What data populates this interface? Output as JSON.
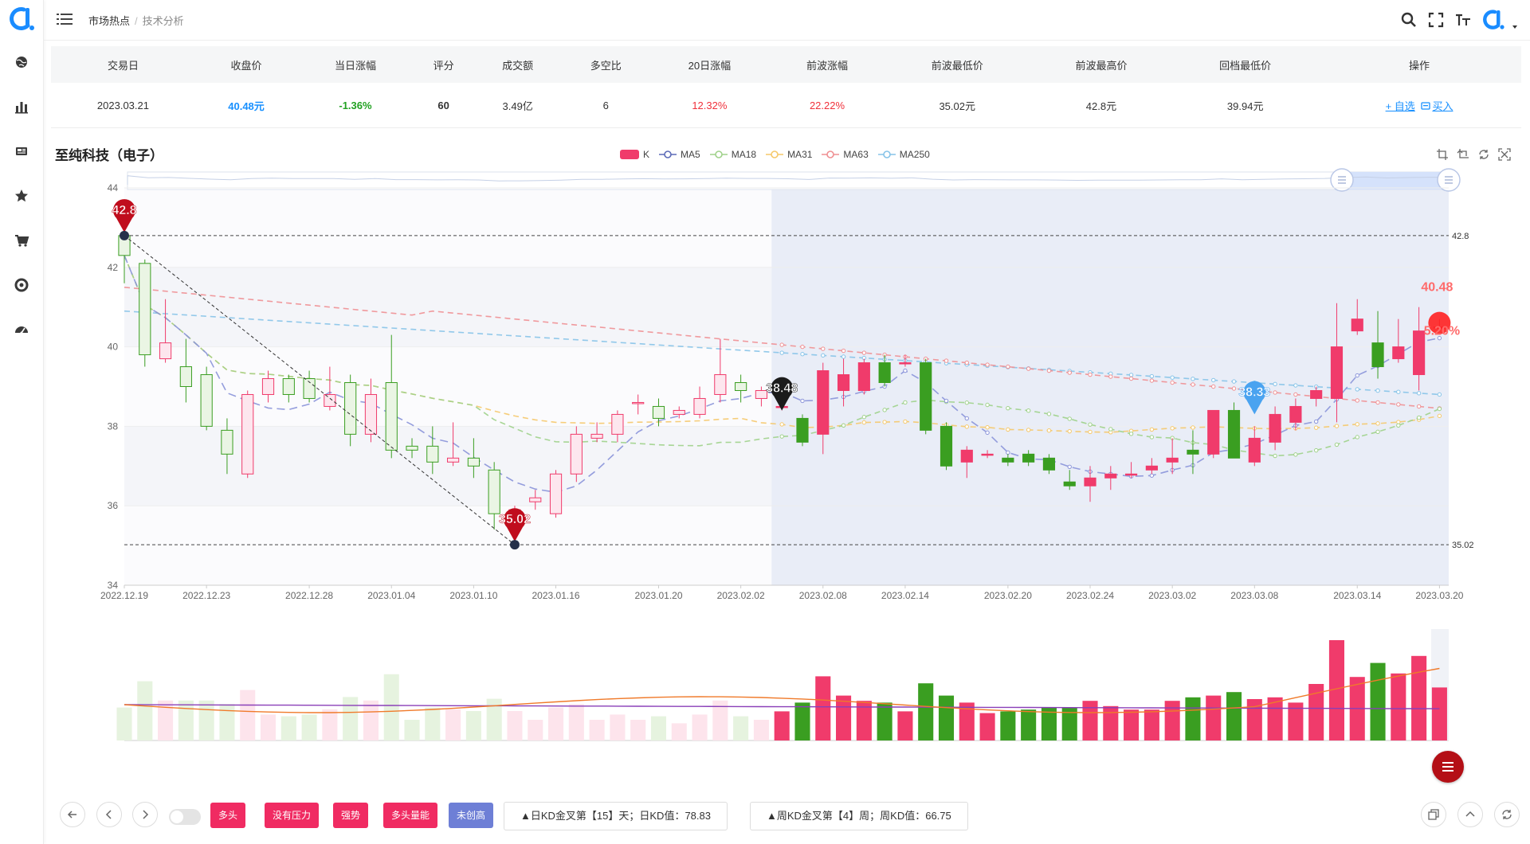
{
  "breadcrumb": {
    "first": "市场热点",
    "sep": "/",
    "second": "技术分析"
  },
  "summary": {
    "headers": [
      "交易日",
      "收盘价",
      "当日涨幅",
      "评分",
      "成交额",
      "多空比",
      "20日涨幅",
      "前波涨幅",
      "前波最低价",
      "前波最高价",
      "回档最低价",
      "操作"
    ],
    "row": {
      "date": "2023.03.21",
      "close": "40.48元",
      "change": "-1.36%",
      "score": "60",
      "turnover": "3.49亿",
      "ratio": "6",
      "change20": "12.32%",
      "wave_change": "22.22%",
      "wave_low": "35.02元",
      "wave_high": "42.8元",
      "pullback_low": "39.94元"
    },
    "actions": {
      "watch": "+ 自选",
      "buy": "买入"
    }
  },
  "stock_title": "至纯科技（电子）",
  "legend": {
    "k": "K",
    "ma5": "MA5",
    "ma18": "MA18",
    "ma31": "MA31",
    "ma63": "MA63",
    "ma250": "MA250"
  },
  "colors": {
    "up": "#f03b6b",
    "down": "#3a9e21",
    "ma5": "#8a93d9",
    "ma18": "#9fd18a",
    "ma31": "#f5c86a",
    "ma63": "#ef8f92",
    "ma250": "#86c3e8",
    "accent": "#1890ff"
  },
  "markers": {
    "top": "42.8",
    "low": "35.02",
    "mid": "38.48",
    "mid2": "38.33",
    "last_price": "40.48",
    "last_pct": "5.20%",
    "ref_high": "42.8",
    "ref_low": "35.02"
  },
  "chart_data": {
    "type": "candlestick",
    "title": "至纯科技（电子）",
    "ylim": [
      34,
      44
    ],
    "y_ticks": [
      "44",
      "42",
      "40",
      "38",
      "36",
      "34"
    ],
    "x_labels": [
      "2022.12.19",
      "2022.12.23",
      "2022.12.28",
      "2023.01.04",
      "2023.01.10",
      "2023.01.16",
      "2023.01.20",
      "2023.02.02",
      "2023.02.08",
      "2023.02.14",
      "2023.02.20",
      "2023.02.24",
      "2023.03.02",
      "2023.03.08",
      "2023.03.14",
      "2023.03.20"
    ],
    "ohlc": [
      [
        42.8,
        42.3,
        41.6,
        42.8
      ],
      [
        42.1,
        39.8,
        39.5,
        42.2
      ],
      [
        39.7,
        40.1,
        39.6,
        41.2
      ],
      [
        39.5,
        39.0,
        38.6,
        40.2
      ],
      [
        39.3,
        38.0,
        37.9,
        39.5
      ],
      [
        37.9,
        37.3,
        36.8,
        38.2
      ],
      [
        36.8,
        38.8,
        36.7,
        38.9
      ],
      [
        38.8,
        39.2,
        38.6,
        39.4
      ],
      [
        39.2,
        38.8,
        38.6,
        39.3
      ],
      [
        39.2,
        38.7,
        38.6,
        39.4
      ],
      [
        38.5,
        38.8,
        38.4,
        39.5
      ],
      [
        39.1,
        37.8,
        37.5,
        39.3
      ],
      [
        37.8,
        38.8,
        37.6,
        39.2
      ],
      [
        39.1,
        37.4,
        37.2,
        40.3
      ],
      [
        37.5,
        37.4,
        37.2,
        37.7
      ],
      [
        37.5,
        37.1,
        36.8,
        38.0
      ],
      [
        37.1,
        37.2,
        37.0,
        38.1
      ],
      [
        37.2,
        37.0,
        36.7,
        37.7
      ],
      [
        36.9,
        35.8,
        35.4,
        37.1
      ],
      [
        35.6,
        35.9,
        35.0,
        36.0
      ],
      [
        36.1,
        36.2,
        35.9,
        36.4
      ],
      [
        35.8,
        36.8,
        35.7,
        36.9
      ],
      [
        36.8,
        37.8,
        36.6,
        38.0
      ],
      [
        37.7,
        37.8,
        37.6,
        38.1
      ],
      [
        37.8,
        38.3,
        37.6,
        38.4
      ],
      [
        38.6,
        38.6,
        38.3,
        38.8
      ],
      [
        38.5,
        38.2,
        38.0,
        38.7
      ],
      [
        38.3,
        38.4,
        38.2,
        38.5
      ],
      [
        38.3,
        38.7,
        38.2,
        39.0
      ],
      [
        38.8,
        39.3,
        38.6,
        40.2
      ],
      [
        39.1,
        38.9,
        38.6,
        39.3
      ],
      [
        38.7,
        38.9,
        38.5,
        39.0
      ],
      [
        38.5,
        38.5,
        38.4,
        38.7
      ],
      [
        38.2,
        37.6,
        37.5,
        38.3
      ],
      [
        37.8,
        39.4,
        37.3,
        39.6
      ],
      [
        38.9,
        39.3,
        38.5,
        39.7
      ],
      [
        38.9,
        39.6,
        38.8,
        39.7
      ],
      [
        39.6,
        39.1,
        39.0,
        39.8
      ],
      [
        39.6,
        39.6,
        39.5,
        39.8
      ],
      [
        39.6,
        37.9,
        37.8,
        39.7
      ],
      [
        38.0,
        37.0,
        36.9,
        38.1
      ],
      [
        37.1,
        37.4,
        36.7,
        37.5
      ],
      [
        37.3,
        37.3,
        37.2,
        37.4
      ],
      [
        37.2,
        37.1,
        37.0,
        37.3
      ],
      [
        37.3,
        37.1,
        37.0,
        37.4
      ],
      [
        37.2,
        36.9,
        36.8,
        37.3
      ],
      [
        36.6,
        36.5,
        36.4,
        36.9
      ],
      [
        36.5,
        36.7,
        36.1,
        37.0
      ],
      [
        36.7,
        36.8,
        36.4,
        37.0
      ],
      [
        36.8,
        36.8,
        36.7,
        37.1
      ],
      [
        36.9,
        37.0,
        36.8,
        37.2
      ],
      [
        37.1,
        37.2,
        36.8,
        37.7
      ],
      [
        37.4,
        37.3,
        36.8,
        37.9
      ],
      [
        37.3,
        38.4,
        37.2,
        38.4
      ],
      [
        38.4,
        37.2,
        37.2,
        38.6
      ],
      [
        37.1,
        37.7,
        37.0,
        38.0
      ],
      [
        37.6,
        38.3,
        37.4,
        38.5
      ],
      [
        38.1,
        38.5,
        37.9,
        38.7
      ],
      [
        38.7,
        38.9,
        38.5,
        39.0
      ],
      [
        38.7,
        40.0,
        38.1,
        41.1
      ],
      [
        40.4,
        40.7,
        40.3,
        41.2
      ],
      [
        40.1,
        39.5,
        39.2,
        40.9
      ],
      [
        39.7,
        40.0,
        39.6,
        40.7
      ],
      [
        39.3,
        40.4,
        38.9,
        41.0
      ],
      [
        40.5,
        40.5,
        40.4,
        40.7
      ]
    ],
    "volume_bars": 65
  },
  "bottom": {
    "tags": [
      "多头",
      "没有压力",
      "强势",
      "多头量能",
      "未创高"
    ],
    "daily_kd": "▲日KD金叉第【15】天；日KD值：78.83",
    "weekly_kd": "▲周KD金叉第【4】周；周KD值：66.75"
  }
}
